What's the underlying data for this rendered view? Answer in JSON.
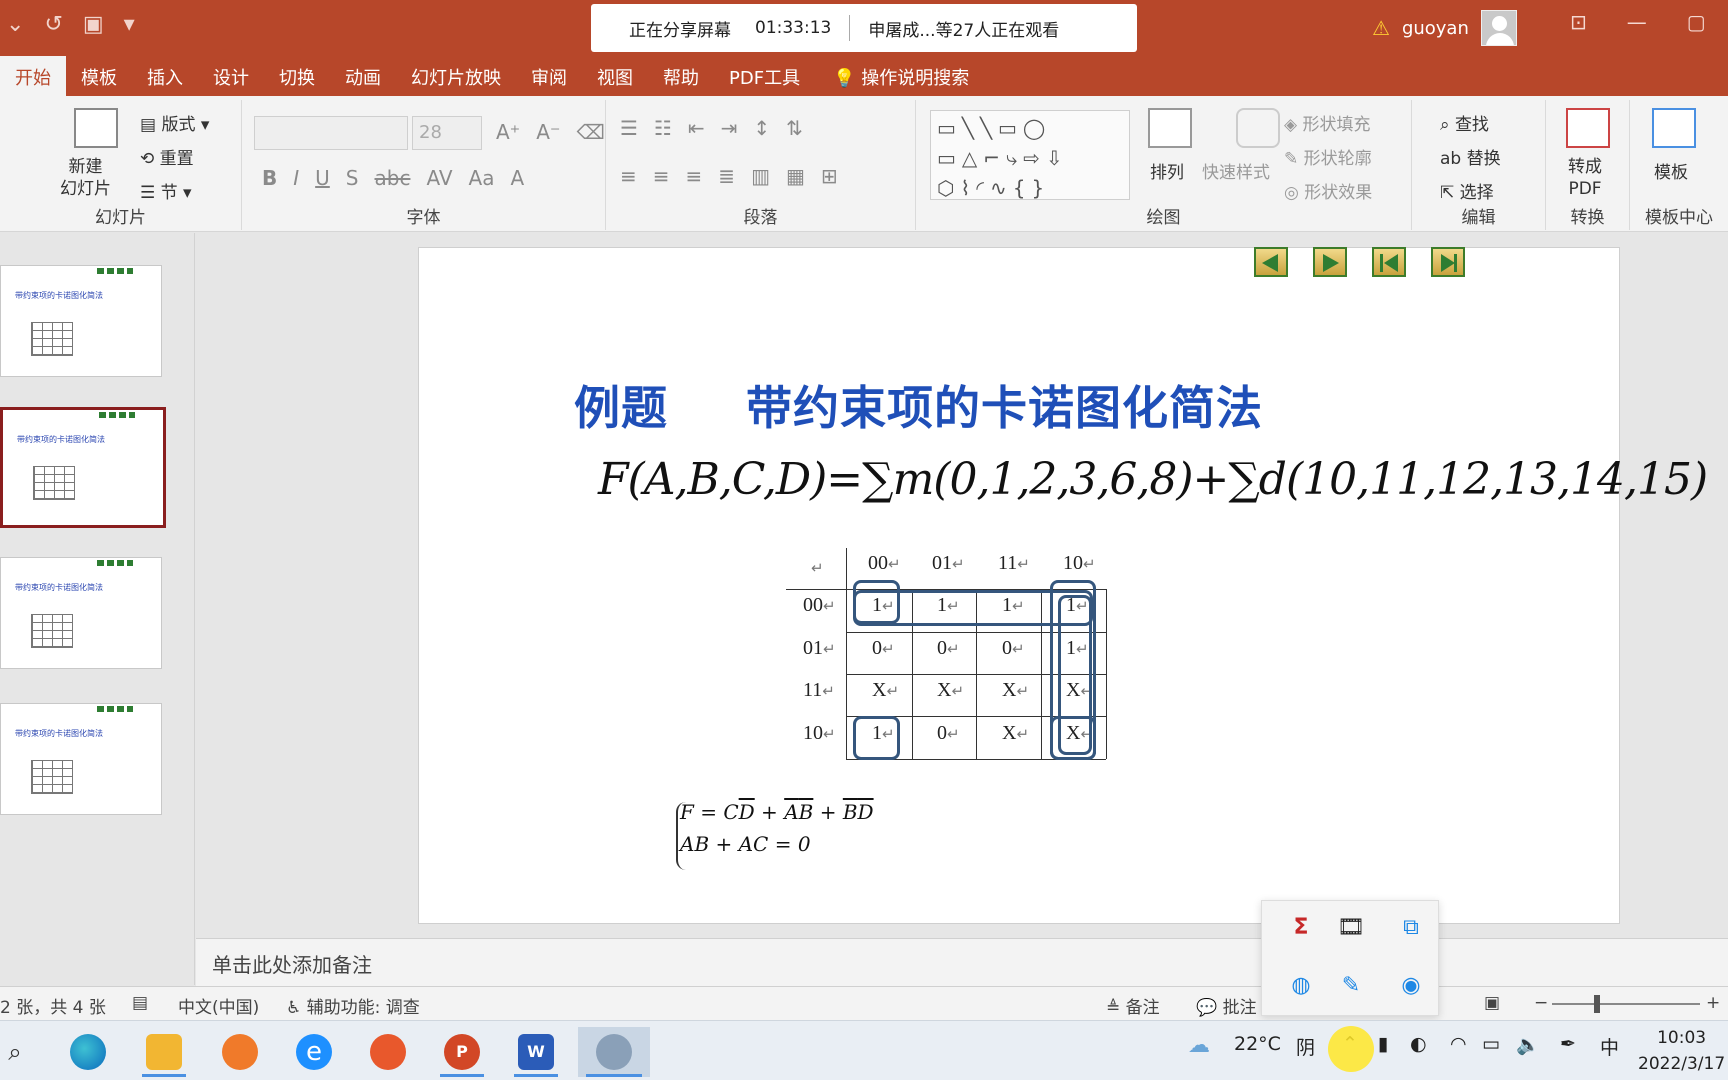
{
  "titlebar": {
    "share_status": "正在分享屏幕",
    "share_time": "01:33:13",
    "viewers": "申屠成...等27人正在观看",
    "username": "guoyan"
  },
  "tabs": [
    "开始",
    "模板",
    "插入",
    "设计",
    "切换",
    "动画",
    "幻灯片放映",
    "审阅",
    "视图",
    "帮助",
    "PDF工具",
    "操作说明搜索"
  ],
  "ribbon": {
    "slides": {
      "new_slide": "新建\n幻灯片",
      "layout": "版式",
      "reset": "重置",
      "section": "节",
      "label": "幻灯片"
    },
    "font": {
      "size": "28",
      "label": "字体"
    },
    "paragraph": {
      "label": "段落"
    },
    "drawing": {
      "arrange": "排列",
      "quick_styles": "快速样式",
      "shape_fill": "形状填充",
      "shape_outline": "形状轮廓",
      "shape_effects": "形状效果",
      "label": "绘图"
    },
    "editing": {
      "find": "查找",
      "replace": "替换",
      "select": "选择",
      "label": "编辑"
    },
    "convert": {
      "to_pdf": "转成\nPDF",
      "label": "转换"
    },
    "template": {
      "name": "模板",
      "label": "模板中心"
    }
  },
  "slide": {
    "title_left": "例题",
    "title_right": "带约束项的卡诺图化简法",
    "formula": "F(A,B,C,D)=∑m(0,1,2,3,6,8)+∑d(10,11,12,13,14,15)",
    "kmap": {
      "col_headers": [
        "00",
        "01",
        "11",
        "10"
      ],
      "row_headers": [
        "00",
        "01",
        "11",
        "10"
      ],
      "rows": [
        [
          "1",
          "1",
          "1",
          "1"
        ],
        [
          "0",
          "0",
          "0",
          "1"
        ],
        [
          "X",
          "X",
          "X",
          "X"
        ],
        [
          "1",
          "0",
          "X",
          "X"
        ]
      ]
    },
    "result_line1": "F = CD + AB + BD",
    "result_line2": "AB + AC = 0"
  },
  "notes_placeholder": "单击此处添加备注",
  "statusbar": {
    "slide_count": "2 张，共 4 张",
    "language": "中文(中国)",
    "accessibility": "辅助功能: 调查",
    "notes": "备注",
    "comments": "批注"
  },
  "taskbar": {
    "weather_temp": "22°C",
    "weather_desc": "阴",
    "ime": "中",
    "time": "10:03",
    "date": "2022/3/17"
  },
  "colors": {
    "accent": "#b7472a",
    "title_blue": "#1f4fb8",
    "loop": "#35567d"
  }
}
